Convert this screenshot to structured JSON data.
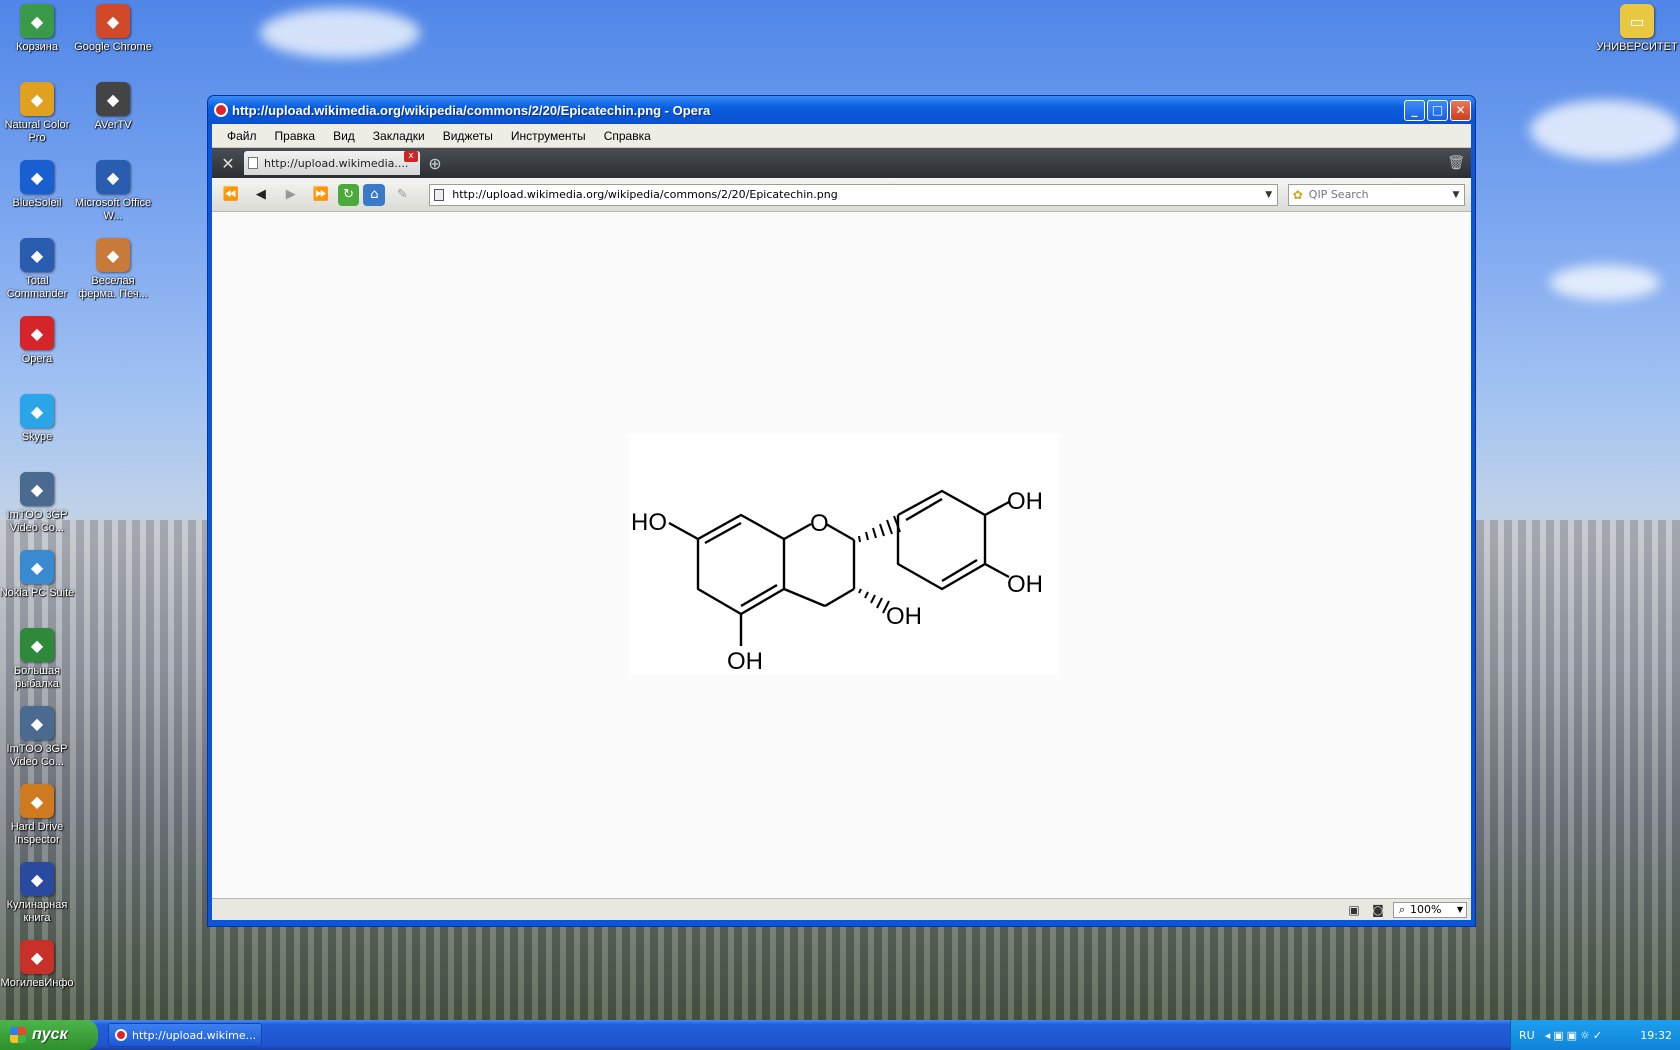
{
  "desktop": {
    "icons_left_col1": [
      {
        "label": "Корзина",
        "icon": "recycle-bin-icon",
        "color": "#3a9a4a"
      },
      {
        "label": "Natural Color Pro",
        "icon": "natural-color-icon",
        "color": "#e0a020"
      },
      {
        "label": "BlueSoleil",
        "icon": "bluetooth-icon",
        "color": "#1a5fd0"
      },
      {
        "label": "Total Commander",
        "icon": "floppy-icon",
        "color": "#2a5db0"
      },
      {
        "label": "Opera",
        "icon": "opera-icon",
        "color": "#d6252a"
      },
      {
        "label": "Skype",
        "icon": "skype-icon",
        "color": "#2aa6e8"
      },
      {
        "label": "ImTOO 3GP Video Co...",
        "icon": "phone-icon",
        "color": "#4a6a90"
      },
      {
        "label": "Nokia PC Suite",
        "icon": "nokia-icon",
        "color": "#3a8ad0"
      },
      {
        "label": "Большая рыбалка",
        "icon": "fishing-icon",
        "color": "#2e8a3a"
      },
      {
        "label": "ImTOO 3GP Video Co...",
        "icon": "phone-icon",
        "color": "#4a6a90"
      },
      {
        "label": "Hard Drive Inspector",
        "icon": "hdd-inspector-icon",
        "color": "#d07a20"
      },
      {
        "label": "Кулинарная книга",
        "icon": "cookbook-icon",
        "color": "#2a4aa0"
      },
      {
        "label": "МогилевИнфо",
        "icon": "star-icon",
        "color": "#c8302a"
      }
    ],
    "icons_left_col2": [
      {
        "label": "Google Chrome",
        "icon": "chrome-icon",
        "color": "#d04a2a"
      },
      {
        "label": "AVerTV",
        "icon": "tv-icon",
        "color": "#444444"
      },
      {
        "label": "Microsoft Office W...",
        "icon": "word-icon",
        "color": "#2a5db0"
      },
      {
        "label": "Веселая ферма. Печ...",
        "icon": "farm-icon",
        "color": "#c87a3a"
      }
    ],
    "icon_right": {
      "label": "УНИВЕРСИТЕТ",
      "icon": "folder-icon",
      "color": "#e8c840"
    }
  },
  "window": {
    "title": "http://upload.wikimedia.org/wikipedia/commons/2/20/Epicatechin.png - Opera",
    "menu": [
      "Файл",
      "Правка",
      "Вид",
      "Закладки",
      "Виджеты",
      "Инструменты",
      "Справка"
    ],
    "tab_title": "http://upload.wikimedia....",
    "address": "http://upload.wikimedia.org/wikipedia/commons/2/20/Epicatechin.png",
    "search_placeholder": "QIP Search",
    "zoom": "100%"
  },
  "molecule": {
    "oh_top_right": "OH",
    "oh_mid_right": "OH",
    "ho_left": "HO",
    "ring_oxygen": "O",
    "oh_c3": "OH",
    "oh_bottom": "OH"
  },
  "taskbar": {
    "start_label": "пуск",
    "task_label": "http://upload.wikime...",
    "lang": "RU",
    "clock": "19:32"
  }
}
